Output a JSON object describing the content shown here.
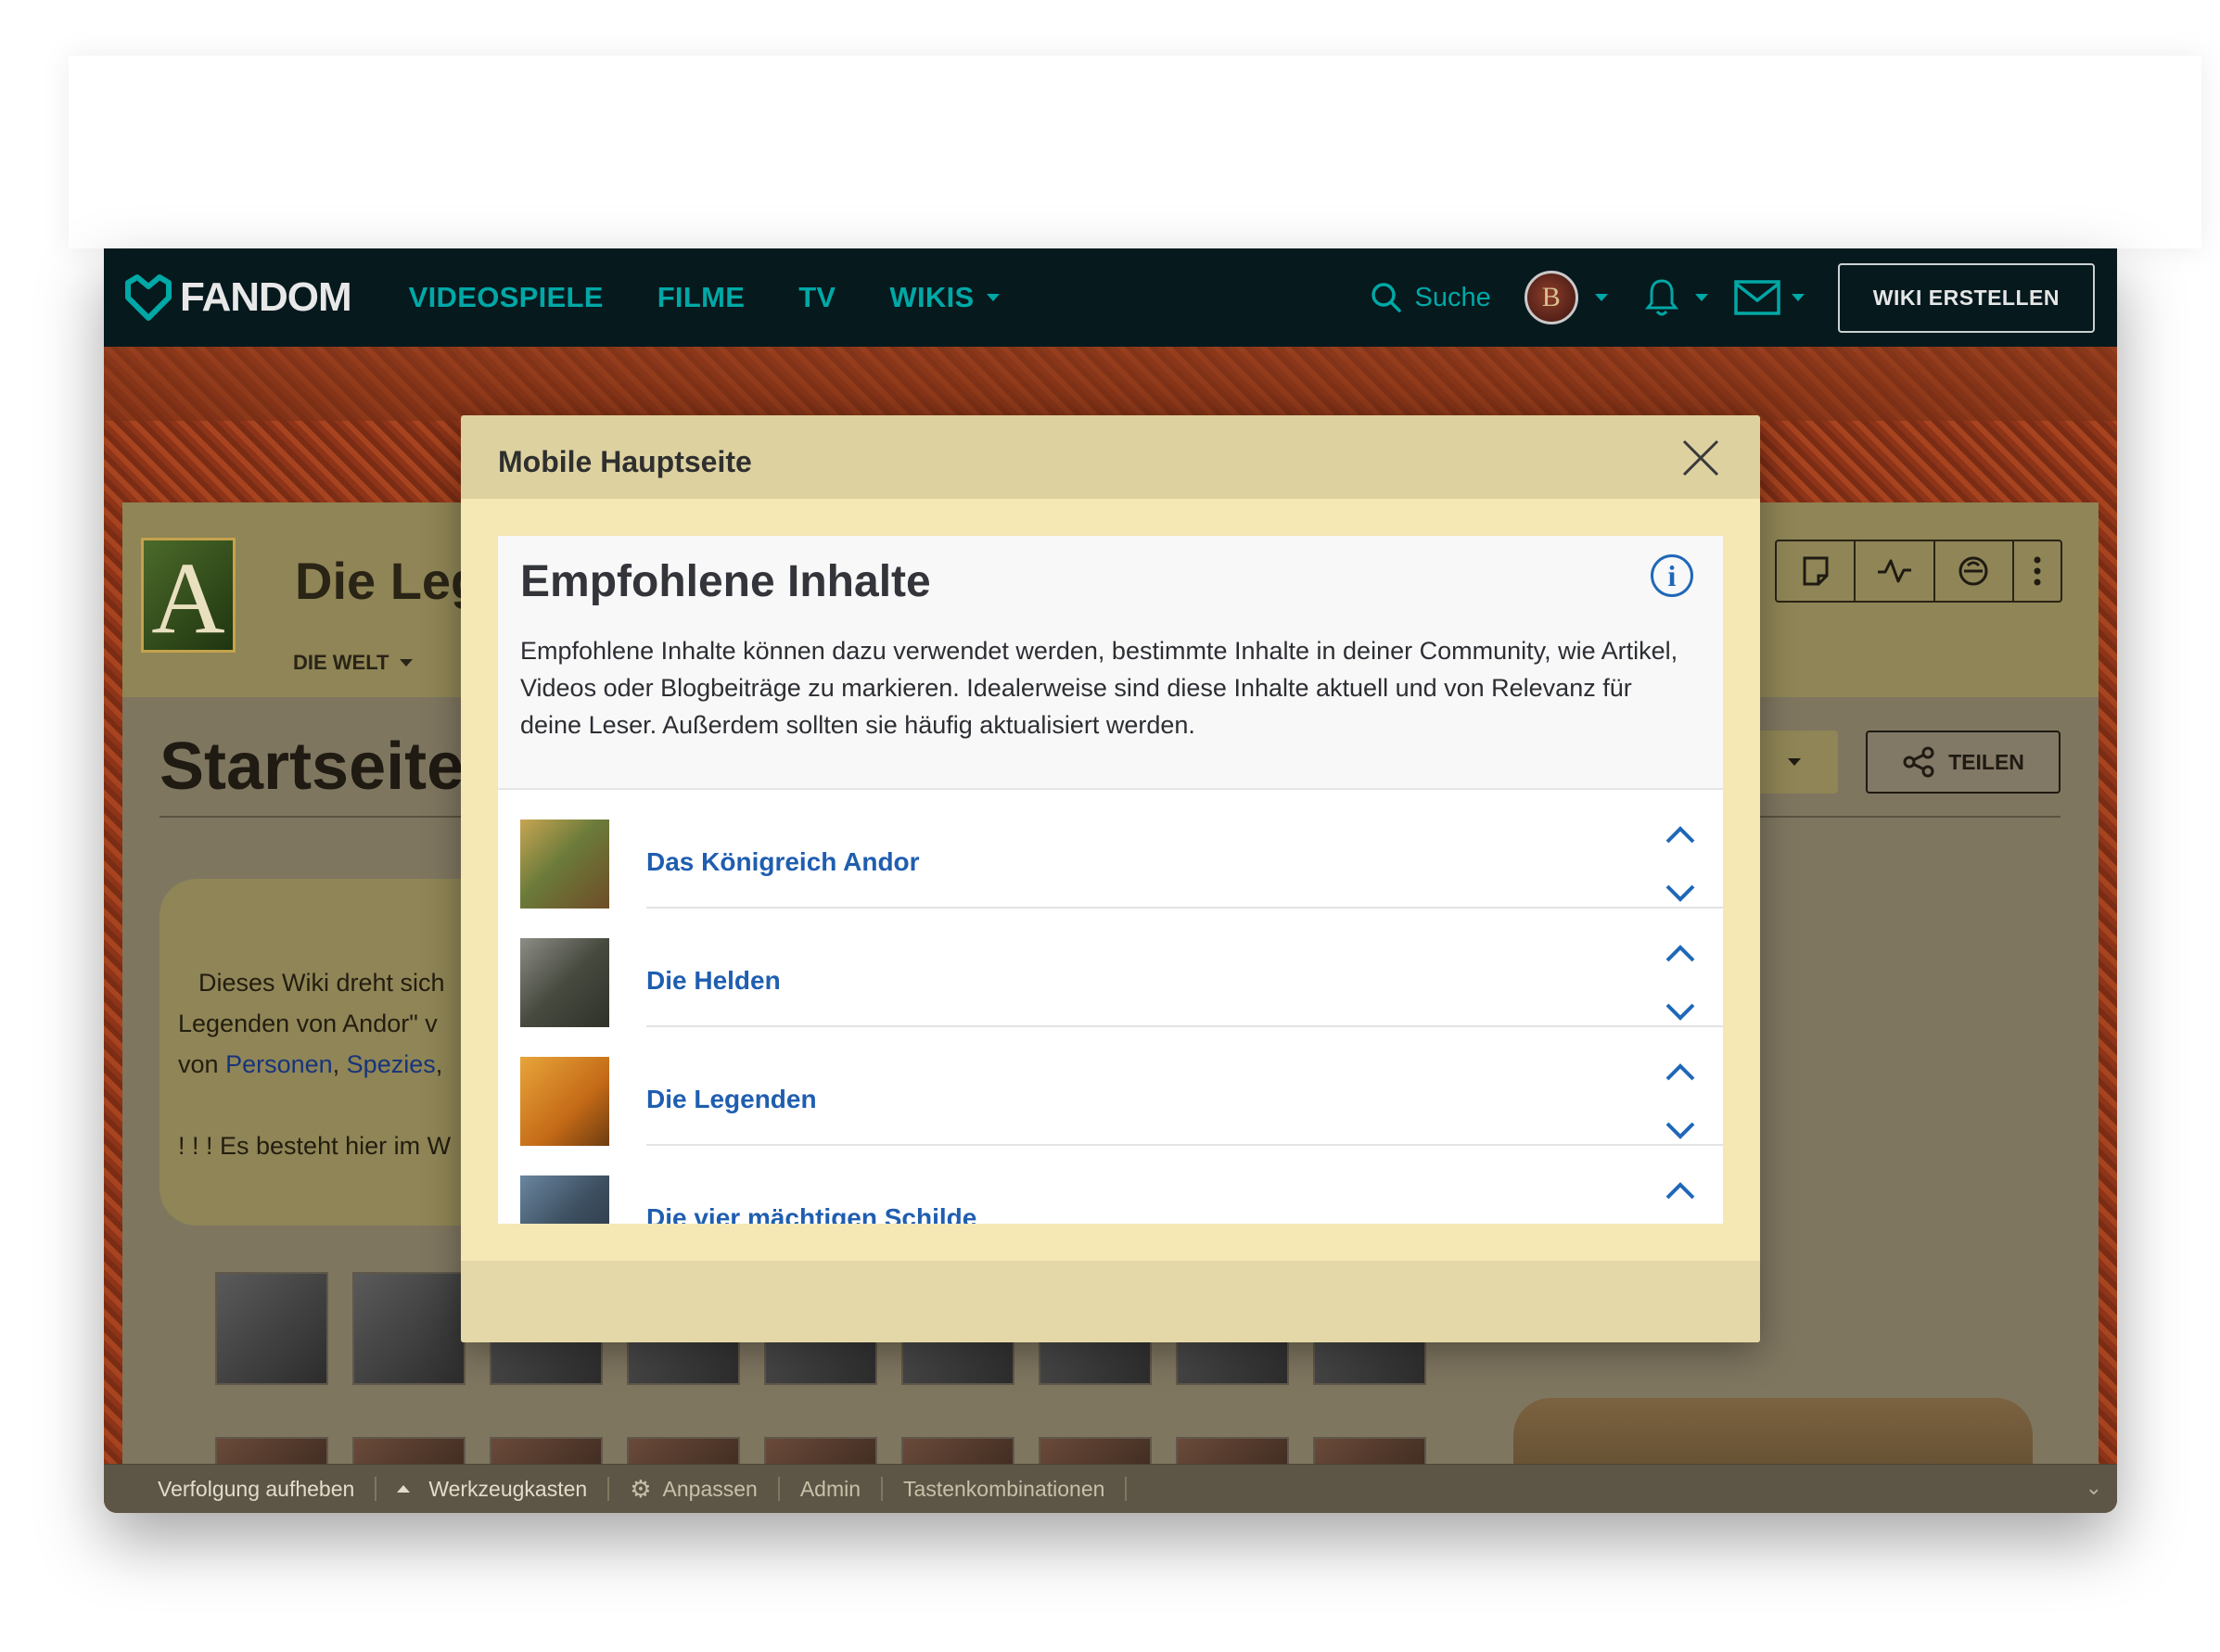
{
  "fandom_nav": {
    "logo": "FANDOM",
    "links": [
      "VIDEOSPIELE",
      "FILME",
      "TV",
      "WIKIS"
    ],
    "search_label": "Suche",
    "avatar_letter": "B",
    "create_wiki": "WIKI ERSTELLEN",
    "accent_color": "#00a8a6"
  },
  "wiki": {
    "title": "Die Leg",
    "logo_letter": "A",
    "menu_world": "DIE WELT",
    "tool_icons": [
      "page-icon",
      "activity-icon",
      "discussions-icon",
      "more-vertical-icon"
    ]
  },
  "page": {
    "title": "Startseite",
    "share": "TEILEN",
    "intro_line1": "Dieses Wiki dreht sich",
    "intro_line2": "Legenden von Andor\" v",
    "intro_line3_prefix": "von",
    "intro_link1": "Personen",
    "intro_link2": "Spezies",
    "intro_line4": "! ! ! Es besteht hier im W"
  },
  "toolbar": {
    "unfollow": "Verfolgung aufheben",
    "toolbox": "Werkzeugkasten",
    "customize": "Anpassen",
    "admin": "Admin",
    "shortcuts": "Tastenkombinationen"
  },
  "modal": {
    "title": "Mobile Hauptseite",
    "section_title": "Empfohlene Inhalte",
    "description": "Empfohlene Inhalte können dazu verwendet werden, bestimmte Inhalte in deiner Community, wie Artikel, Videos oder Blogbeiträge zu markieren. Idealerweise sind diese Inhalte aktuell und von Relevanz für deine Leser. Außerdem sollten sie häufig aktualisiert werden.",
    "items": [
      {
        "label": "Das Königreich Andor"
      },
      {
        "label": "Die Helden"
      },
      {
        "label": "Die Legenden"
      },
      {
        "label": "Die vier mächtigen Schilde"
      }
    ]
  }
}
